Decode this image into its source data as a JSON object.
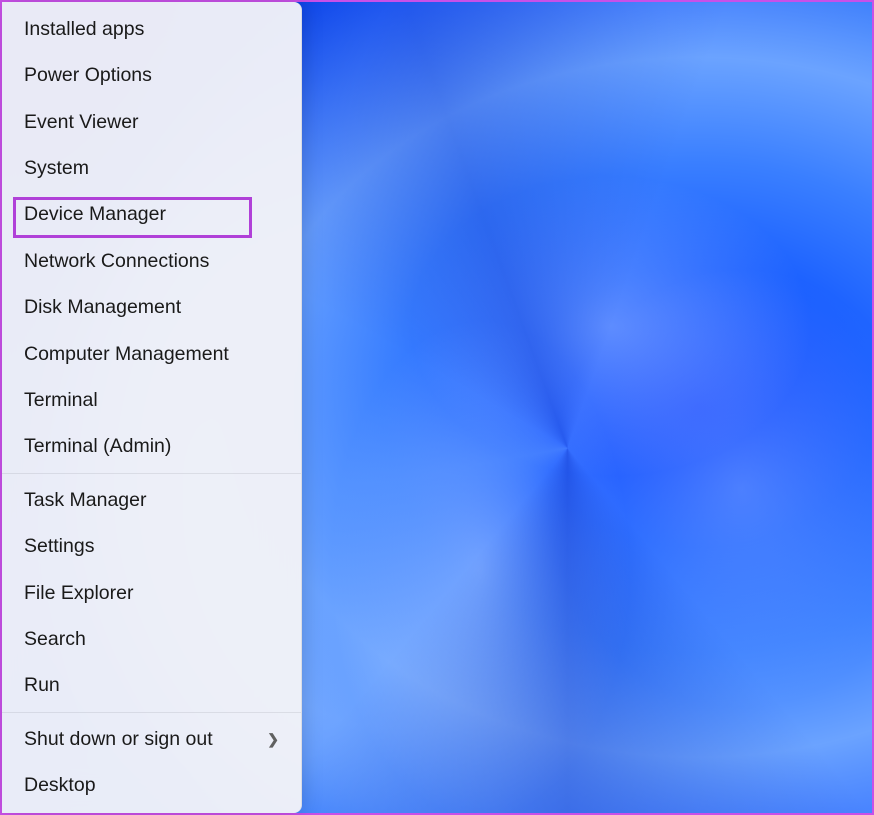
{
  "menu": {
    "group1": [
      {
        "label": "Installed apps",
        "name": "menu-installed-apps"
      },
      {
        "label": "Power Options",
        "name": "menu-power-options"
      },
      {
        "label": "Event Viewer",
        "name": "menu-event-viewer"
      },
      {
        "label": "System",
        "name": "menu-system"
      },
      {
        "label": "Device Manager",
        "name": "menu-device-manager",
        "highlighted": true
      },
      {
        "label": "Network Connections",
        "name": "menu-network-connections"
      },
      {
        "label": "Disk Management",
        "name": "menu-disk-management"
      },
      {
        "label": "Computer Management",
        "name": "menu-computer-management"
      },
      {
        "label": "Terminal",
        "name": "menu-terminal"
      },
      {
        "label": "Terminal (Admin)",
        "name": "menu-terminal-admin"
      }
    ],
    "group2": [
      {
        "label": "Task Manager",
        "name": "menu-task-manager"
      },
      {
        "label": "Settings",
        "name": "menu-settings"
      },
      {
        "label": "File Explorer",
        "name": "menu-file-explorer"
      },
      {
        "label": "Search",
        "name": "menu-search"
      },
      {
        "label": "Run",
        "name": "menu-run"
      }
    ],
    "group3": [
      {
        "label": "Shut down or sign out",
        "name": "menu-shutdown",
        "submenu": true
      },
      {
        "label": "Desktop",
        "name": "menu-desktop"
      }
    ]
  },
  "annotation": {
    "highlight_color": "#b040d8"
  }
}
